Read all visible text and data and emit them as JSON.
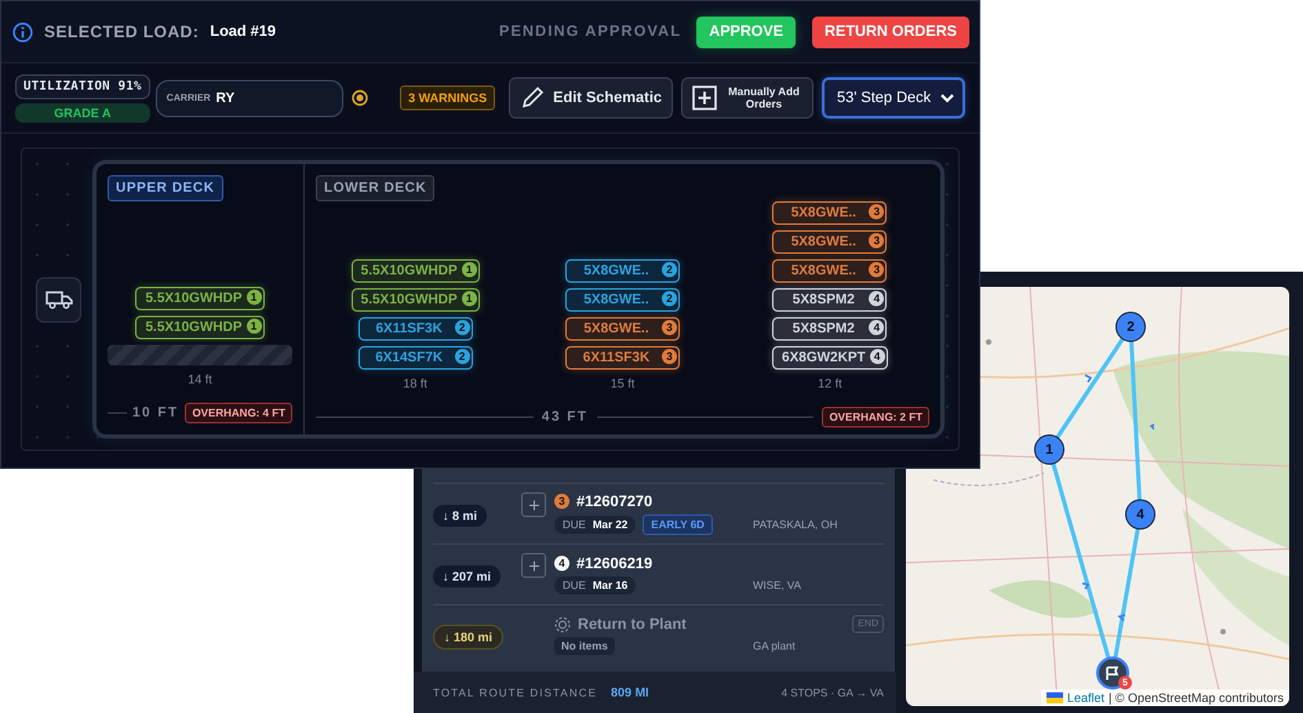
{
  "header": {
    "label": "SELECTED LOAD:",
    "load": "Load #19",
    "status": "PENDING APPROVAL",
    "buttons": [
      {
        "label": "APPROVE",
        "kind": "approve"
      },
      {
        "label": "RETURN ORDERS",
        "kind": "return"
      }
    ]
  },
  "toolbar": {
    "utilization": "UTILIZATION 91%",
    "grade": "GRADE A",
    "carrier": {
      "label": "CARRIER",
      "value": "RY"
    },
    "warnings": "3 WARNINGS",
    "edit": "Edit Schematic",
    "add": "Manually Add Orders",
    "trailer": "53' Step Deck"
  },
  "decks": [
    {
      "name": "UPPER DECK",
      "selected": true,
      "length": "10 FT",
      "overhang": "OVERHANG: 4 FT",
      "columns": [
        {
          "length": "14 ft",
          "empty_slot": true,
          "cargo": [
            {
              "label": "5.5X10GWHDP",
              "stop": "1",
              "color": "#7cb342"
            },
            {
              "label": "5.5X10GWHDP",
              "stop": "1",
              "color": "#7cb342"
            }
          ]
        }
      ]
    },
    {
      "name": "LOWER DECK",
      "selected": false,
      "length": "43 FT",
      "overhang": "OVERHANG: 2 FT",
      "columns": [
        {
          "length": "18 ft",
          "empty_slot": false,
          "cargo": [
            {
              "label": "5.5X10GWHDP",
              "stop": "1",
              "color": "#7cb342"
            },
            {
              "label": "5.5X10GWHDP",
              "stop": "1",
              "color": "#7cb342"
            },
            {
              "label": "6X11SF3K",
              "stop": "2",
              "color": "#29a3e0"
            },
            {
              "label": "6X14SF7K",
              "stop": "2",
              "color": "#29a3e0"
            }
          ]
        },
        {
          "length": "15 ft",
          "empty_slot": false,
          "cargo": [
            {
              "label": "5X8GWE..",
              "stop": "2",
              "color": "#29a3e0"
            },
            {
              "label": "5X8GWE..",
              "stop": "2",
              "color": "#29a3e0"
            },
            {
              "label": "5X8GWE..",
              "stop": "3",
              "color": "#e07b39"
            },
            {
              "label": "6X11SF3K",
              "stop": "3",
              "color": "#e07b39"
            }
          ]
        },
        {
          "length": "12 ft",
          "empty_slot": false,
          "cargo": [
            {
              "label": "5X8GWE..",
              "stop": "3",
              "color": "#e07b39"
            },
            {
              "label": "5X8GWE..",
              "stop": "3",
              "color": "#e07b39"
            },
            {
              "label": "5X8GWE..",
              "stop": "3",
              "color": "#e07b39"
            },
            {
              "label": "5X8SPM2",
              "stop": "4",
              "color": "#d0d4dc"
            },
            {
              "label": "5X8SPM2",
              "stop": "4",
              "color": "#d0d4dc"
            },
            {
              "label": "6X8GW2KPT",
              "stop": "4",
              "color": "#d0d4dc"
            }
          ]
        }
      ]
    }
  ],
  "stops": [
    {
      "kind": "order",
      "distance": "↓ 8 mi",
      "stop": "3",
      "color": "#e07b39",
      "order": "#12607270",
      "due_label": "DUE",
      "due": "Mar 22",
      "tag": "EARLY 6D",
      "place": "PATASKALA, OH"
    },
    {
      "kind": "order",
      "distance": "↓ 207 mi",
      "stop": "4",
      "color": "#f2f4f7",
      "order": "#12606219",
      "due_label": "DUE",
      "due": "Mar 16",
      "place": "WISE, VA"
    },
    {
      "kind": "end",
      "distance": "↓ 180 mi",
      "order": "Return to Plant",
      "items": "No items",
      "place": "GA plant",
      "tag": "END"
    }
  ],
  "summary": {
    "label": "TOTAL ROUTE DISTANCE",
    "value": "809 MI",
    "detail": "4 STOPS · GA → VA"
  },
  "map": {
    "markers": [
      {
        "kind": "stop",
        "label": "2"
      },
      {
        "kind": "stop",
        "label": "1"
      },
      {
        "kind": "stop",
        "label": "4"
      },
      {
        "kind": "end",
        "label": "5"
      }
    ],
    "attribution": {
      "link": "Leaflet",
      "text": "| © OpenStreetMap contributors"
    }
  }
}
